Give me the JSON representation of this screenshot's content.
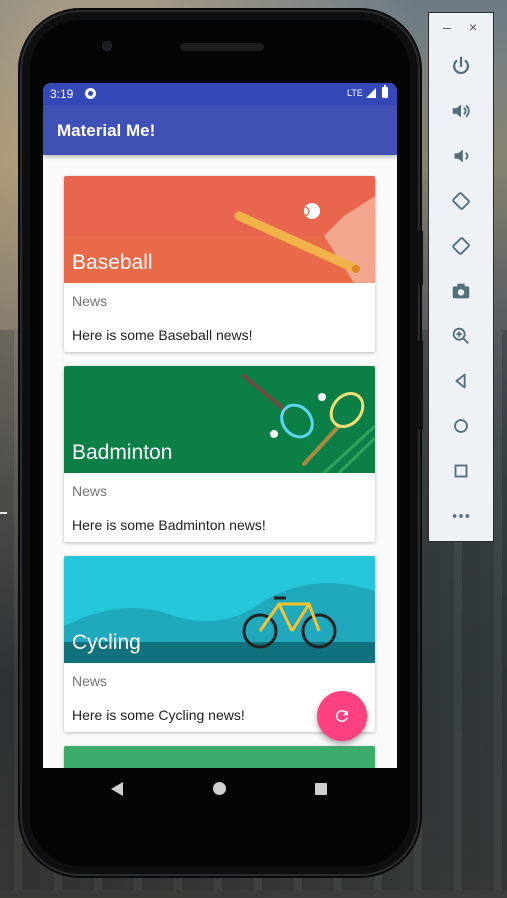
{
  "status_bar": {
    "time": "3:19",
    "network": "LTE"
  },
  "app_bar": {
    "title": "Material Me!"
  },
  "cards": [
    {
      "title": "Baseball",
      "subtitle": "News",
      "info": "Here is some Baseball news!",
      "color": "#e8654e"
    },
    {
      "title": "Badminton",
      "subtitle": "News",
      "info": "Here is some Badminton news!",
      "color": "#0b7f45"
    },
    {
      "title": "Cycling",
      "subtitle": "News",
      "info": "Here is some Cycling news!",
      "color": "#26c6da"
    },
    {
      "title": "",
      "subtitle": "",
      "info": "",
      "color": "#3cab6b"
    }
  ],
  "fab": {
    "icon": "refresh-icon",
    "color": "#ff4081"
  },
  "nav_bar": {
    "icons": [
      "back-icon",
      "home-icon",
      "recents-icon"
    ]
  },
  "emulator_panel": {
    "window_controls": [
      "minimize",
      "close"
    ],
    "window_controls_labels": {
      "minimize": "–",
      "close": "×"
    },
    "buttons": [
      "power-icon",
      "volume-up-icon",
      "volume-down-icon",
      "rotate-left-icon",
      "rotate-right-icon",
      "screenshot-icon",
      "zoom-icon",
      "back-icon",
      "home-icon",
      "overview-icon",
      "more-icon"
    ]
  },
  "colors": {
    "status_bar": "#3548b7",
    "app_bar": "#3f51b5",
    "accent": "#ff4081"
  }
}
